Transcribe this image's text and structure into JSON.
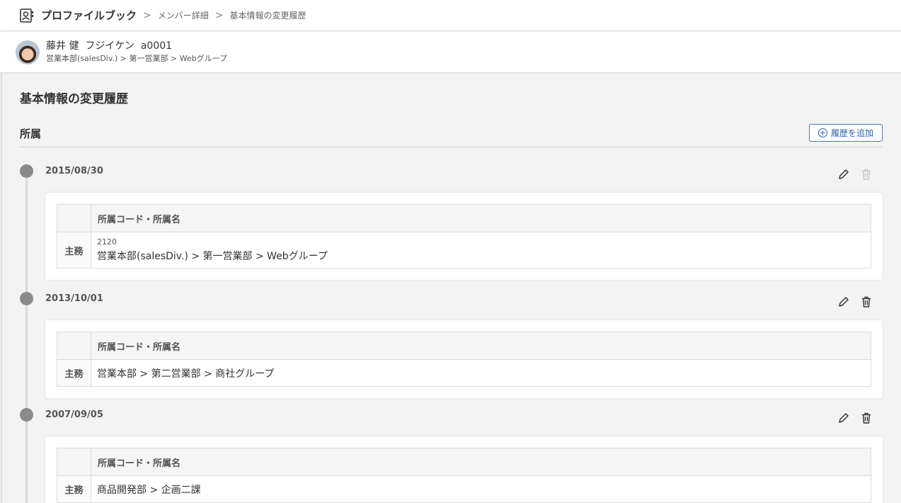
{
  "header": {
    "app_name": "プロファイルブック",
    "breadcrumb": [
      "メンバー詳細",
      "基本情報の変更履歴"
    ],
    "app_icon": "profile-book-icon",
    "separator": ">"
  },
  "member": {
    "name_line": "藤井 健  フジイケン  a0001",
    "department_path": "営業本部(salesDiv.) > 第一営業部 > Webグループ"
  },
  "page": {
    "title": "基本情報の変更履歴"
  },
  "section": {
    "title": "所属",
    "add_button_label": "履歴を追加",
    "add_icon": "plus-circle-icon"
  },
  "entries": [
    {
      "date": "2015/08/30",
      "column_header": "所属コード・所属名",
      "row_label": "主務",
      "code": "2120",
      "name": "営業本部(salesDiv.) > 第一営業部 > Webグループ",
      "delete_enabled": false
    },
    {
      "date": "2013/10/01",
      "column_header": "所属コード・所属名",
      "row_label": "主務",
      "code": "",
      "name": "営業本部 > 第二営業部 > 商社グループ",
      "delete_enabled": true
    },
    {
      "date": "2007/09/05",
      "column_header": "所属コード・所属名",
      "row_label": "主務",
      "code": "",
      "name": "商品開発部 > 企画二課",
      "delete_enabled": true
    }
  ],
  "colors": {
    "accent": "#2f5fa3",
    "timeline_dot": "#8a8a8a",
    "icon_active": "#333333",
    "icon_disabled": "#c8c8c8"
  }
}
